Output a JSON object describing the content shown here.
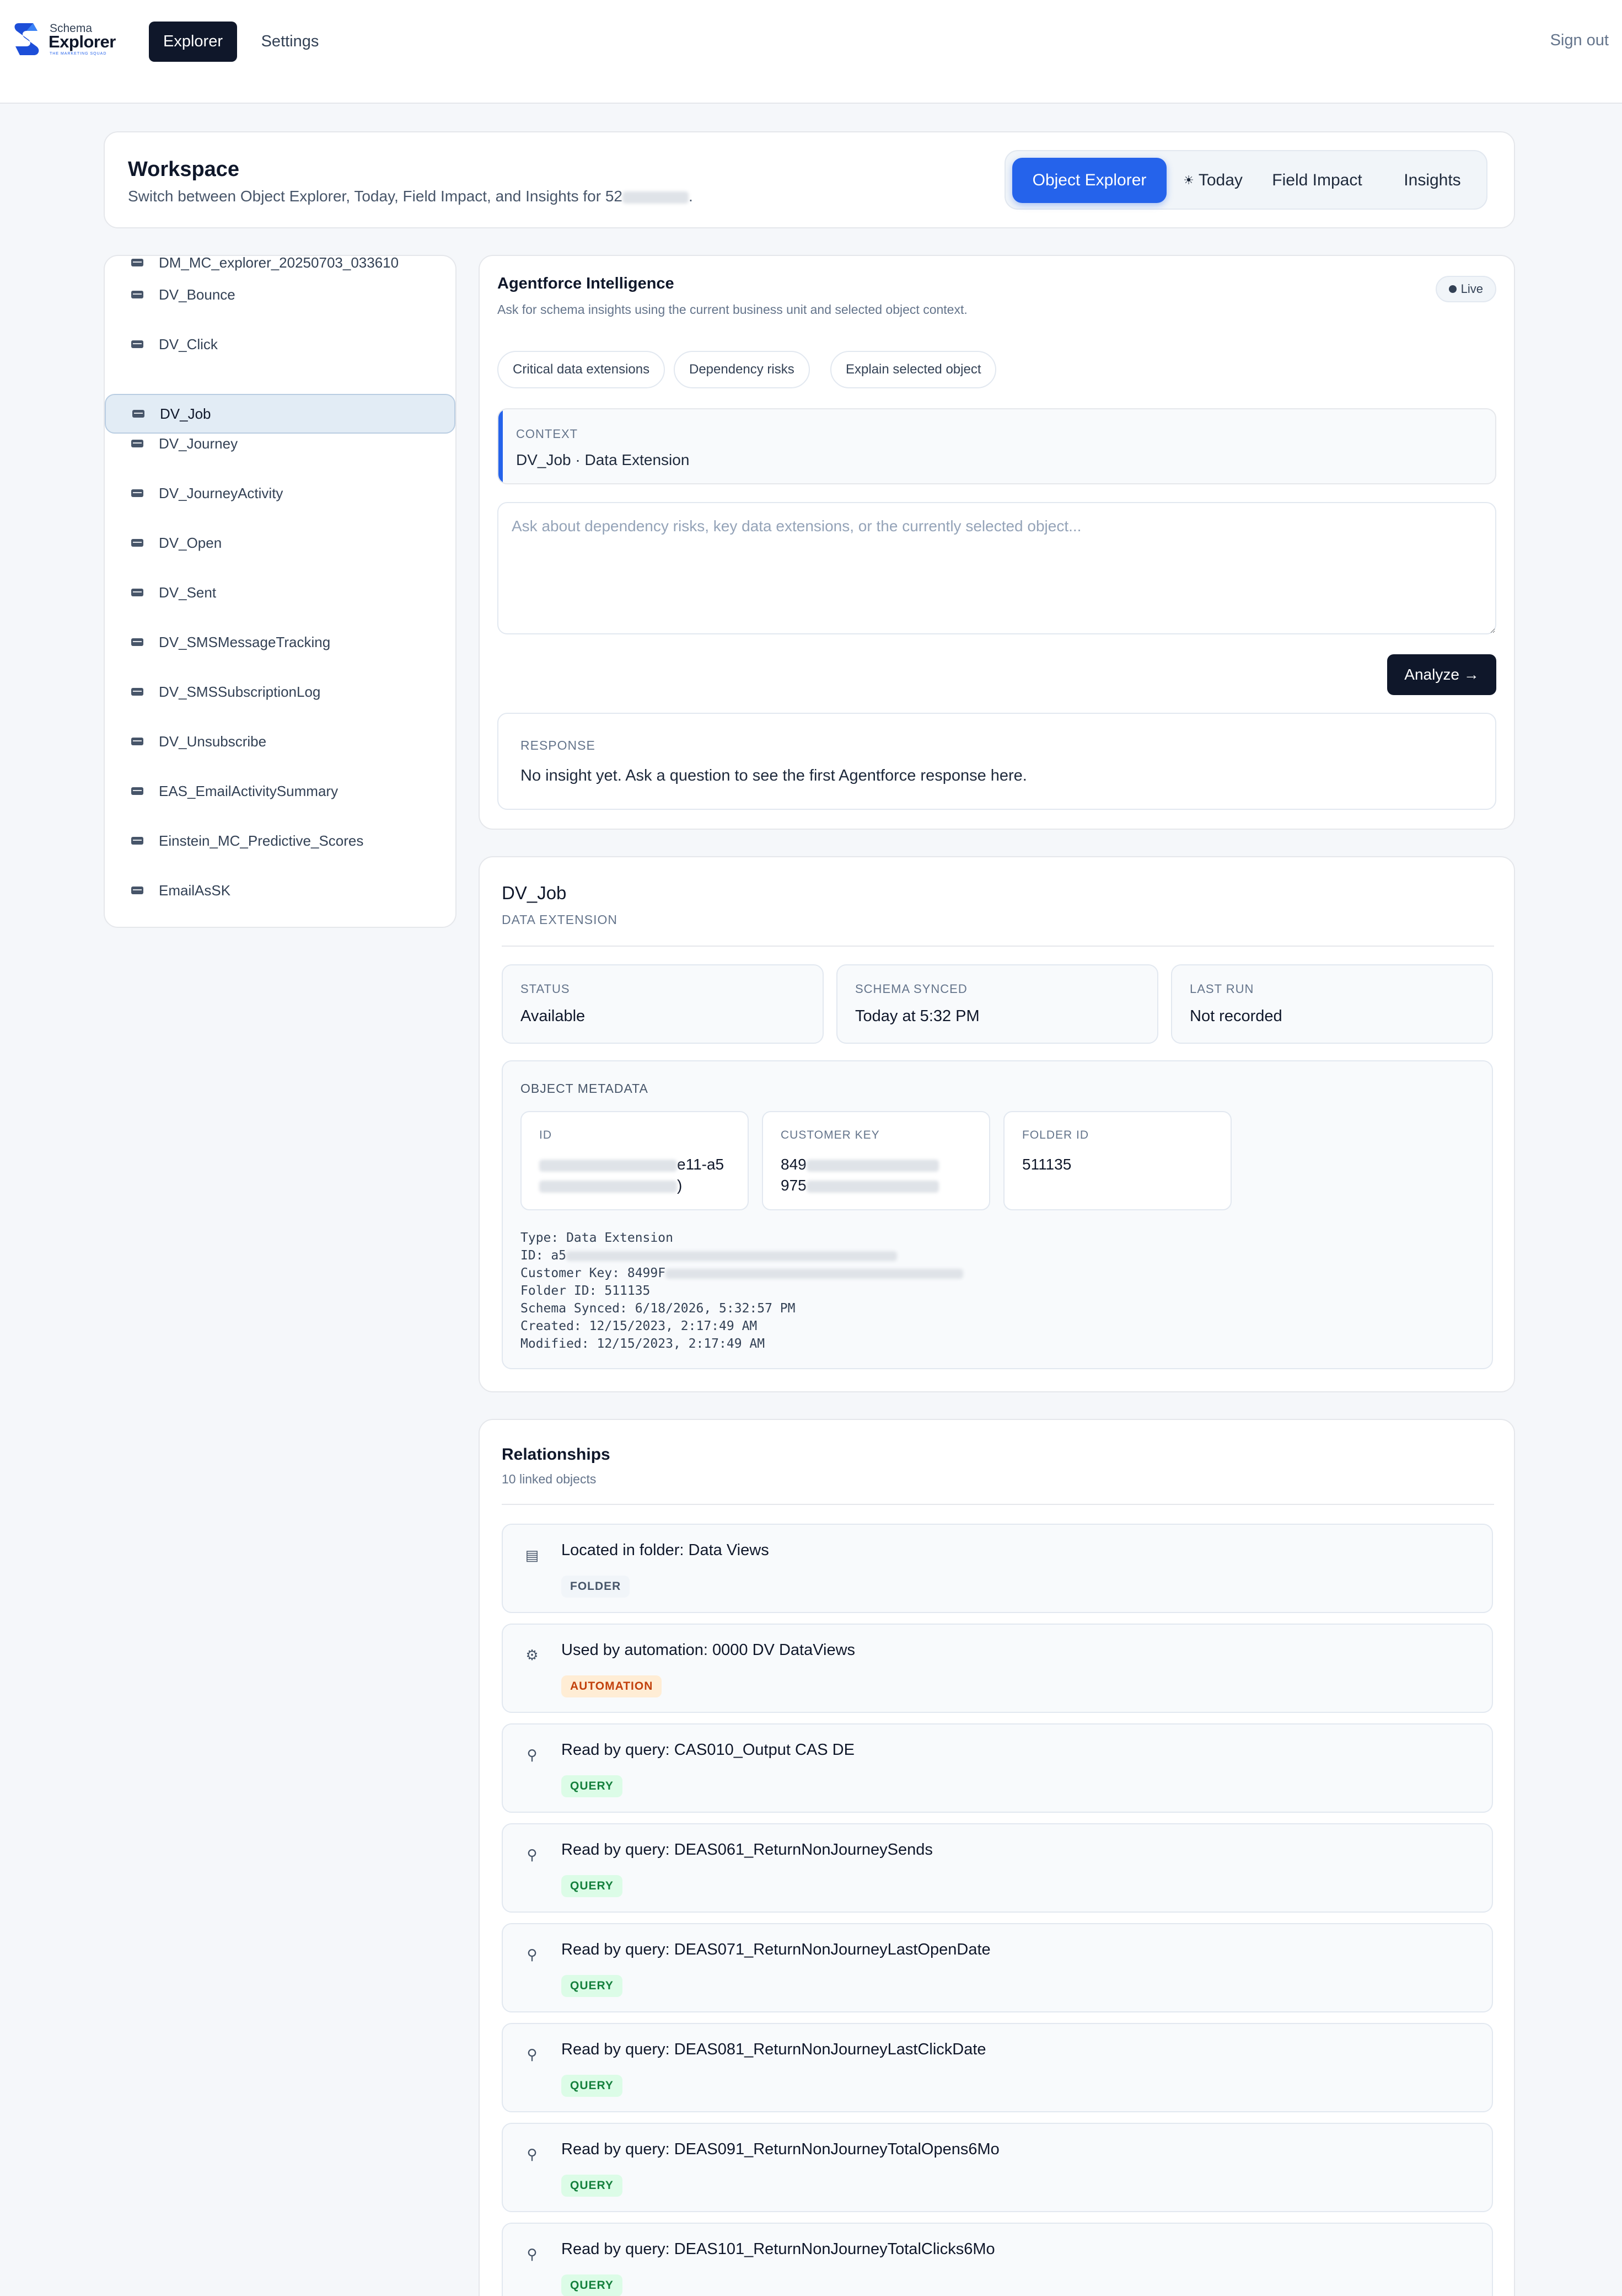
{
  "app": {
    "logo_small": "Schema",
    "logo_big": "Explorer",
    "logo_tag": "THE MARKETING SQUAD",
    "nav": [
      {
        "label": "Explorer"
      },
      {
        "label": "Settings"
      }
    ],
    "signout": "Sign out"
  },
  "workspace": {
    "title": "Workspace",
    "subtitle_prefix": "Switch between Object Explorer, Today, Field Impact, and Insights for 52",
    "subtitle_suffix": ".",
    "segments": [
      "Object Explorer",
      "Today",
      "Field Impact",
      "Insights"
    ],
    "segment_today_icon": "☀"
  },
  "sidebar": {
    "items": [
      {
        "label": "DM_MC_explorer_20250703_033610"
      },
      {
        "label": "DV_Bounce"
      },
      {
        "label": "DV_Click"
      },
      {
        "label": "DV_Job"
      },
      {
        "label": "DV_Journey"
      },
      {
        "label": "DV_JourneyActivity"
      },
      {
        "label": "DV_Open"
      },
      {
        "label": "DV_Sent"
      },
      {
        "label": "DV_SMSMessageTracking"
      },
      {
        "label": "DV_SMSSubscriptionLog"
      },
      {
        "label": "DV_Unsubscribe"
      },
      {
        "label": "EAS_EmailActivitySummary"
      },
      {
        "label": "Einstein_MC_Predictive_Scores"
      },
      {
        "label": "EmailAsSK"
      }
    ],
    "selected": "DV_Job"
  },
  "ai": {
    "title": "Agentforce Intelligence",
    "subtitle": "Ask for schema insights using the current business unit and selected object context.",
    "live": "Live",
    "chips": [
      "Critical data extensions",
      "Dependency risks",
      "Explain selected object"
    ],
    "context_label": "CONTEXT",
    "context_value": "DV_Job · Data Extension",
    "ask_placeholder": "Ask about dependency risks, key data extensions, or the currently selected object...",
    "analyze": "Analyze →",
    "response_label": "RESPONSE",
    "response_text": "No insight yet. Ask a question to see the first Agentforce response here."
  },
  "object": {
    "name": "DV_Job",
    "type": "DATA EXTENSION",
    "stats": [
      {
        "label": "STATUS",
        "value": "Available"
      },
      {
        "label": "SCHEMA SYNCED",
        "value": "Today at 5:32 PM"
      },
      {
        "label": "LAST RUN",
        "value": "Not recorded"
      }
    ],
    "metadata_label": "OBJECT METADATA",
    "meta_boxes": [
      {
        "label": "ID",
        "line1": "e11-a5",
        "line2": ")"
      },
      {
        "label": "CUSTOMER KEY",
        "line1": "849",
        "line2": "975"
      },
      {
        "label": "FOLDER ID",
        "line1": "511135",
        "line2": ""
      }
    ],
    "raw": [
      "Type: Data Extension",
      "ID: a5",
      "Customer Key: 8499F",
      "Folder ID: 511135",
      "Schema Synced: 6/18/2026, 5:32:57 PM",
      "Created: 12/15/2023, 2:17:49 AM",
      "Modified: 12/15/2023, 2:17:49 AM"
    ]
  },
  "relationships": {
    "title": "Relationships",
    "subtitle": "10 linked objects",
    "items": [
      {
        "icon": "folder-icon",
        "text": "Located in folder: Data Views",
        "badge": "FOLDER",
        "badge_bg": "#f1f5f9",
        "badge_fg": "#475569"
      },
      {
        "icon": "gear-icon",
        "text": "Used by automation: 0000 DV DataViews",
        "badge": "AUTOMATION",
        "badge_bg": "#ffedd5",
        "badge_fg": "#c2410c"
      },
      {
        "icon": "magnifier-icon",
        "text": "Read by query: CAS010_Output CAS DE",
        "badge": "QUERY",
        "badge_bg": "#dcfce7",
        "badge_fg": "#15803d"
      },
      {
        "icon": "magnifier-icon",
        "text": "Read by query: DEAS061_ReturnNonJourneySends",
        "badge": "QUERY",
        "badge_bg": "#dcfce7",
        "badge_fg": "#15803d"
      },
      {
        "icon": "magnifier-icon",
        "text": "Read by query: DEAS071_ReturnNonJourneyLastOpenDate",
        "badge": "QUERY",
        "badge_bg": "#dcfce7",
        "badge_fg": "#15803d"
      },
      {
        "icon": "magnifier-icon",
        "text": "Read by query: DEAS081_ReturnNonJourneyLastClickDate",
        "badge": "QUERY",
        "badge_bg": "#dcfce7",
        "badge_fg": "#15803d"
      },
      {
        "icon": "magnifier-icon",
        "text": "Read by query: DEAS091_ReturnNonJourneyTotalOpens6Mo",
        "badge": "QUERY",
        "badge_bg": "#dcfce7",
        "badge_fg": "#15803d"
      },
      {
        "icon": "magnifier-icon",
        "text": "Read by query: DEAS101_ReturnNonJourneyTotalClicks6Mo",
        "badge": "QUERY",
        "badge_bg": "#dcfce7",
        "badge_fg": "#15803d"
      }
    ]
  },
  "colors": {
    "accent": "#2563eb",
    "dark": "#0f172a",
    "selected_bg": "#e2ecf5"
  }
}
